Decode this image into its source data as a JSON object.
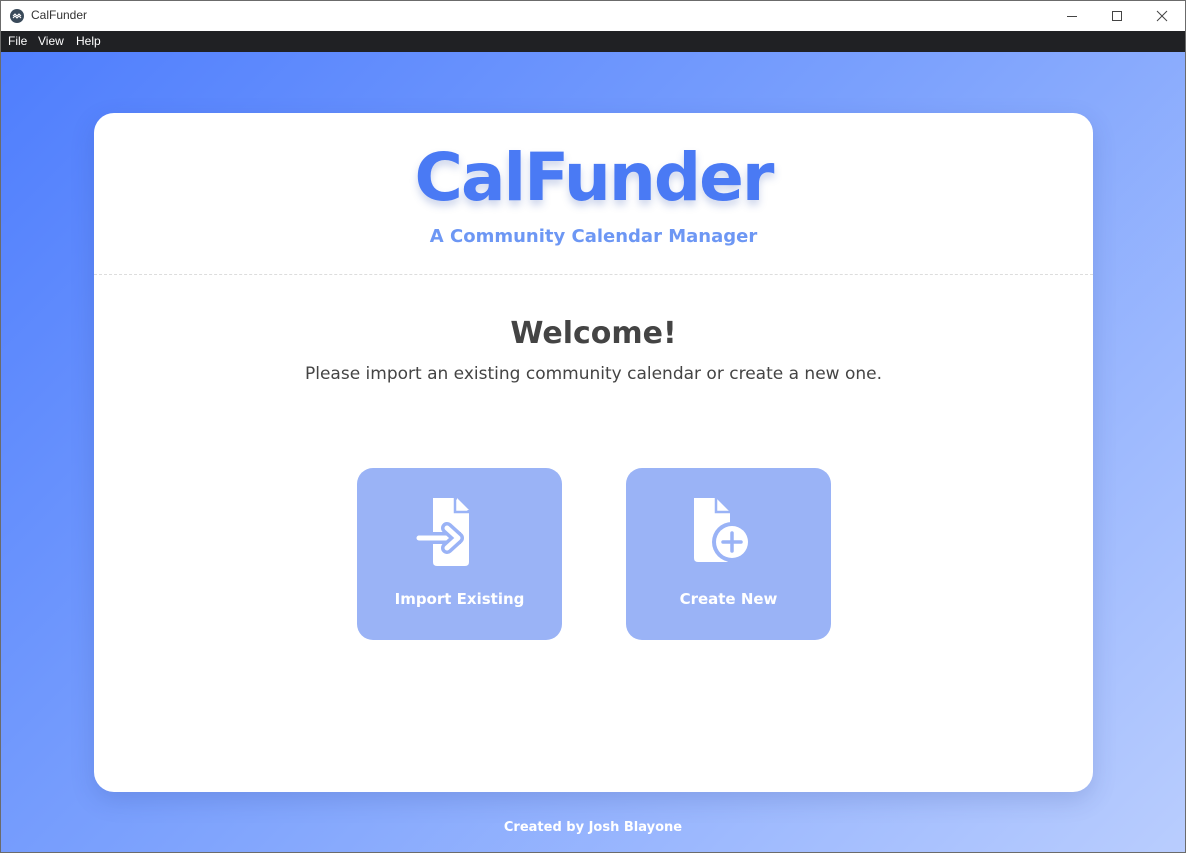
{
  "window": {
    "title": "CalFunder",
    "app_icon": "calfunder-app-icon",
    "controls": [
      "minimize-icon",
      "maximize-icon",
      "close-icon"
    ]
  },
  "menu": {
    "items": [
      "File",
      "View",
      "Help"
    ]
  },
  "header": {
    "logo": "CalFunder",
    "subtitle": "A Community Calendar Manager"
  },
  "welcome": {
    "heading": "Welcome!",
    "instruction": "Please import an existing community calendar or create a new one."
  },
  "actions": [
    {
      "label": "Import Existing",
      "icon": "file-import-icon"
    },
    {
      "label": "Create New",
      "icon": "file-add-icon"
    }
  ],
  "footer": {
    "credit": "Created by Josh Blayone"
  },
  "colors": {
    "accent": "#4a7af4",
    "subtitle": "#6d97f4",
    "button": "#9ab3f6",
    "menubar": "#202124",
    "gradient_start": "#4f7efd",
    "gradient_end": "#b9cdfe",
    "text": "#444444"
  }
}
